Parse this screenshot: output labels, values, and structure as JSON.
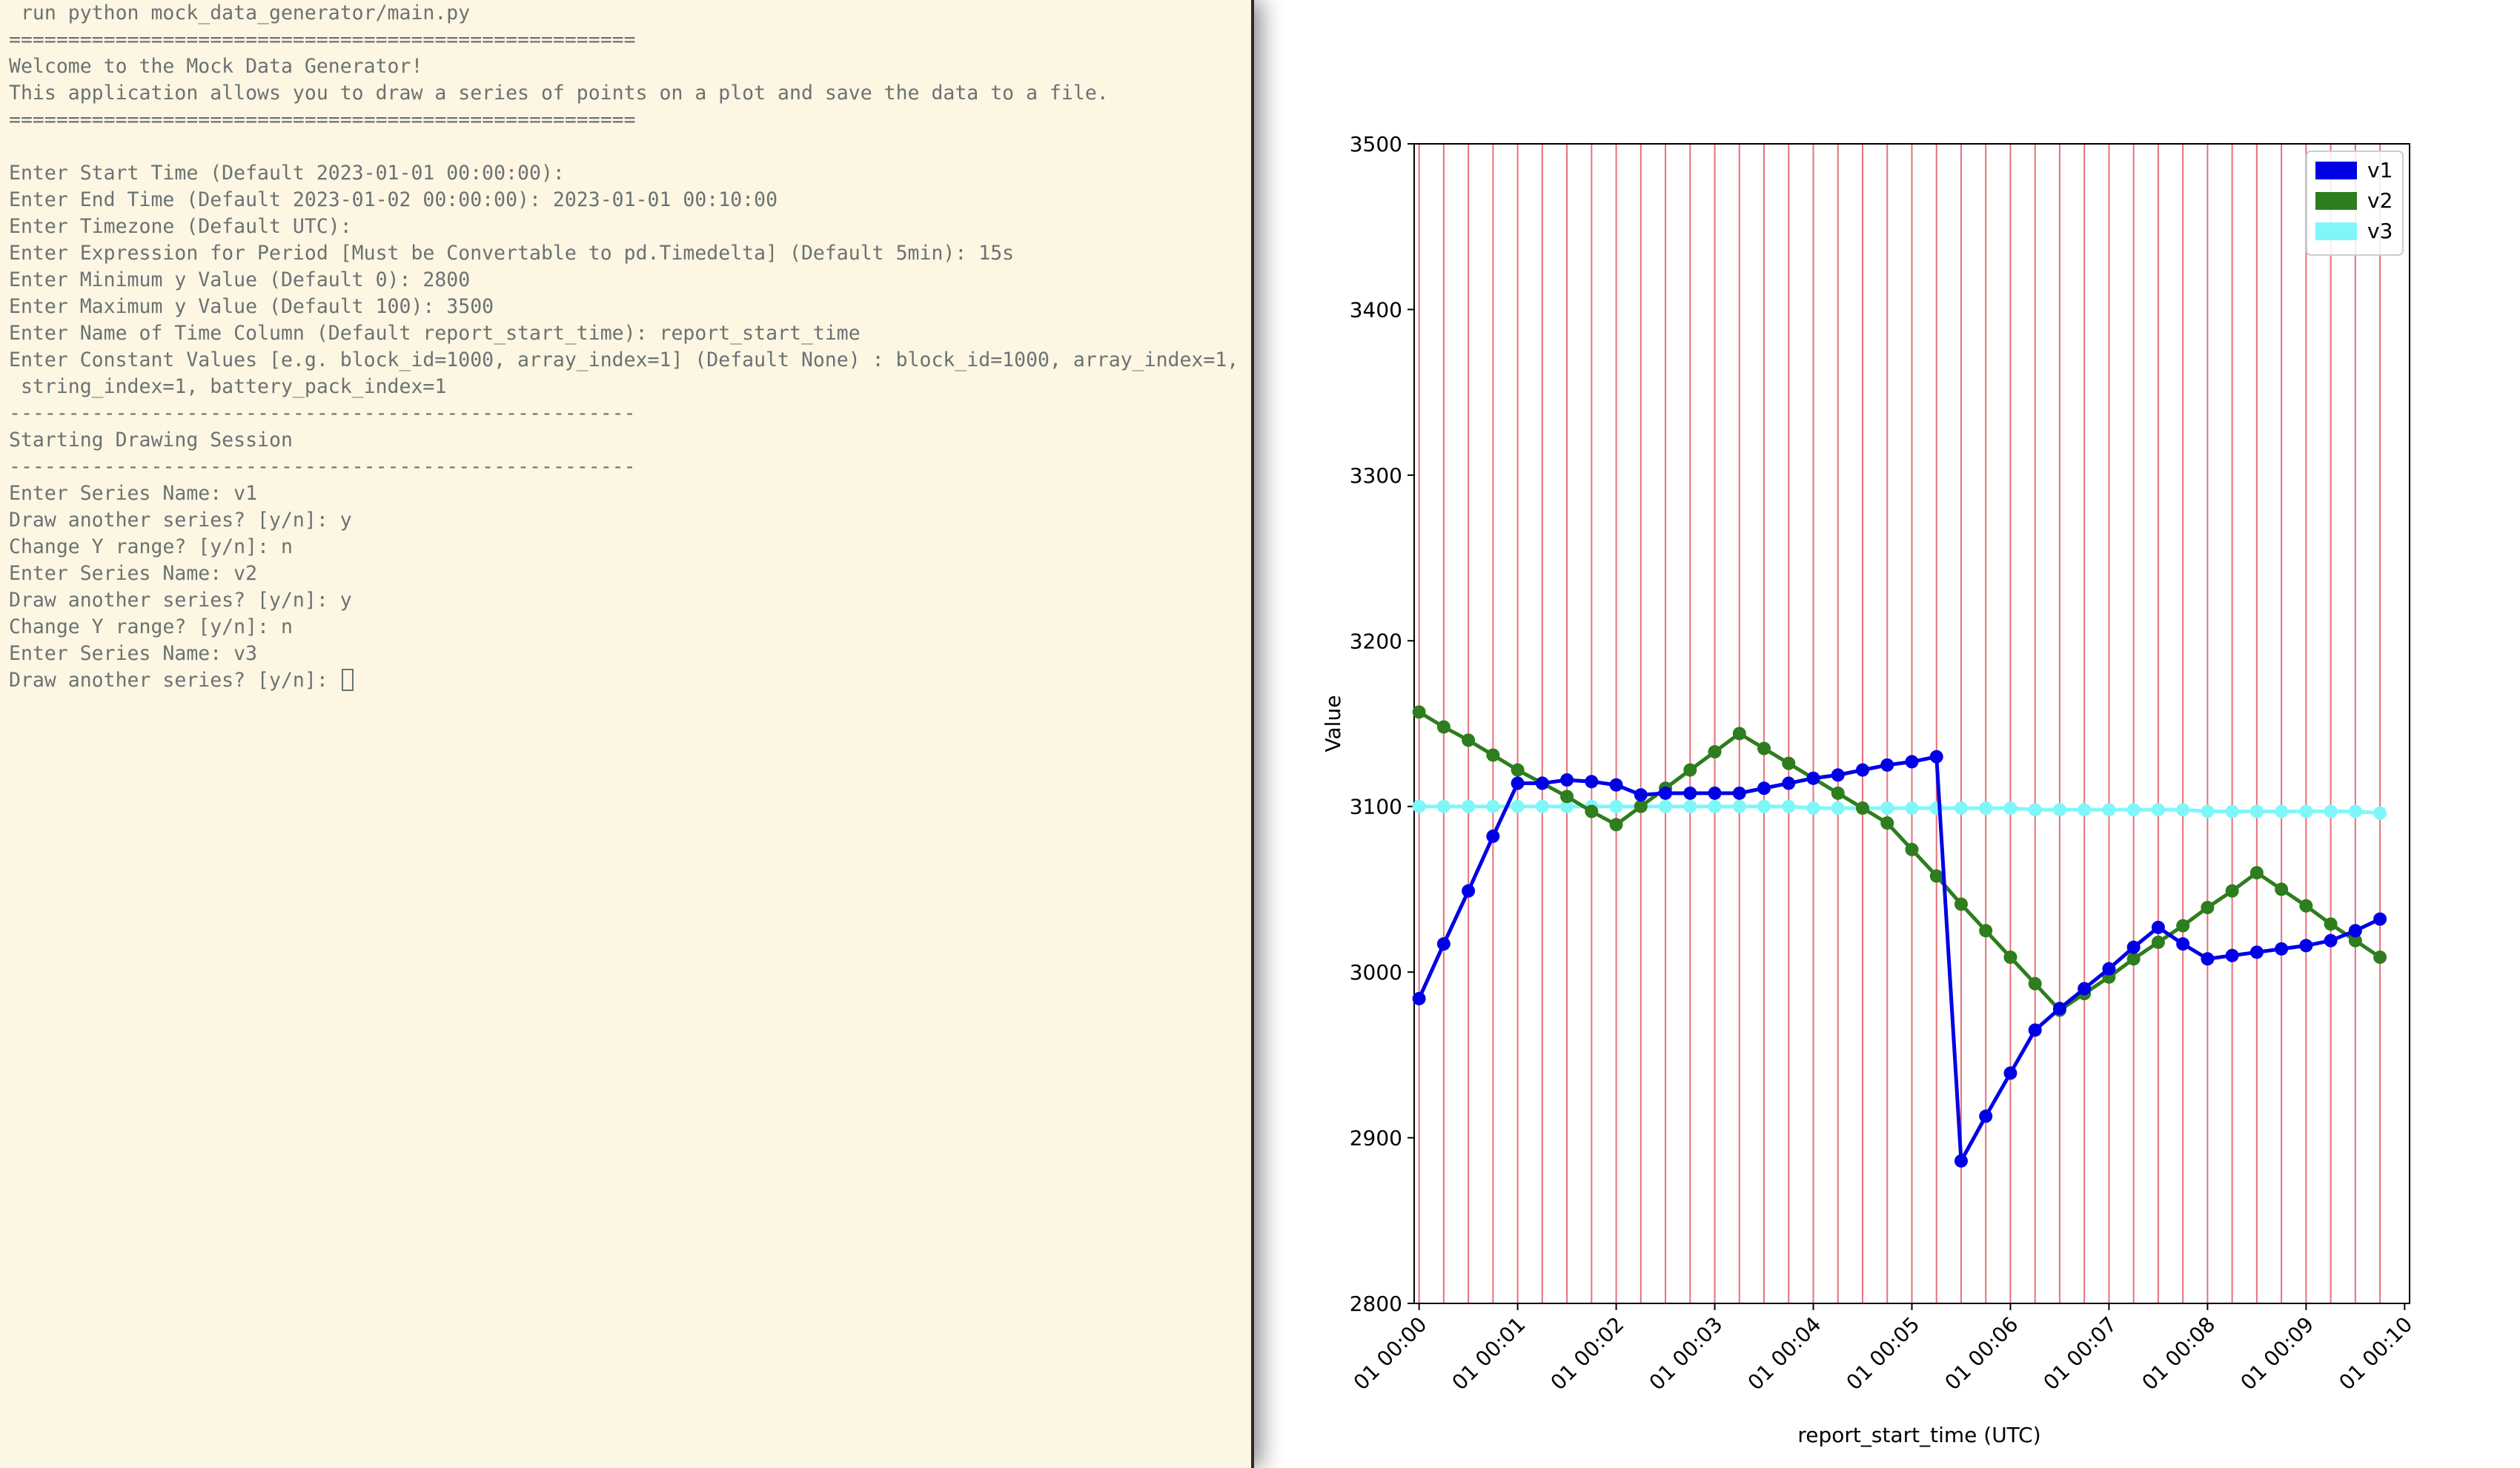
{
  "terminal": {
    "lines": [
      " run python mock_data_generator/main.py",
      "=====================================================",
      "Welcome to the Mock Data Generator!",
      "This application allows you to draw a series of points on a plot and save the data to a file.",
      "=====================================================",
      "",
      "Enter Start Time (Default 2023-01-01 00:00:00):",
      "Enter End Time (Default 2023-01-02 00:00:00): 2023-01-01 00:10:00",
      "Enter Timezone (Default UTC):",
      "Enter Expression for Period [Must be Convertable to pd.Timedelta] (Default 5min): 15s",
      "Enter Minimum y Value (Default 0): 2800",
      "Enter Maximum y Value (Default 100): 3500",
      "Enter Name of Time Column (Default report_start_time): report_start_time",
      "Enter Constant Values [e.g. block_id=1000, array_index=1] (Default None) : block_id=1000, array_index=1,",
      " string_index=1, battery_pack_index=1",
      "-----------------------------------------------------",
      "Starting Drawing Session",
      "-----------------------------------------------------",
      "Enter Series Name: v1",
      "Draw another series? [y/n]: y",
      "Change Y range? [y/n]: n",
      "Enter Series Name: v2",
      "Draw another series? [y/n]: y",
      "Change Y range? [y/n]: n",
      "Enter Series Name: v3"
    ],
    "prompt": "Draw another series? [y/n]: ",
    "colors": {
      "background": "#fdf6e3",
      "text": "#6b7273"
    }
  },
  "chart_data": {
    "type": "line",
    "title": "",
    "xlabel": "report_start_time (UTC)",
    "ylabel": "Value",
    "ylim": [
      2800,
      3500
    ],
    "y_ticks": [
      2800,
      2900,
      3000,
      3100,
      3200,
      3300,
      3400,
      3500
    ],
    "x_ticks": [
      "01 00:00",
      "01 00:01",
      "01 00:02",
      "01 00:03",
      "01 00:04",
      "01 00:05",
      "01 00:06",
      "01 00:07",
      "01 00:08",
      "01 00:09",
      "01 00:10"
    ],
    "x": [
      "00:00:00",
      "00:00:15",
      "00:00:30",
      "00:00:45",
      "00:01:00",
      "00:01:15",
      "00:01:30",
      "00:01:45",
      "00:02:00",
      "00:02:15",
      "00:02:30",
      "00:02:45",
      "00:03:00",
      "00:03:15",
      "00:03:30",
      "00:03:45",
      "00:04:00",
      "00:04:15",
      "00:04:30",
      "00:04:45",
      "00:05:00",
      "00:05:15",
      "00:05:30",
      "00:05:45",
      "00:06:00",
      "00:06:15",
      "00:06:30",
      "00:06:45",
      "00:07:00",
      "00:07:15",
      "00:07:30",
      "00:07:45",
      "00:08:00",
      "00:08:15",
      "00:08:30",
      "00:08:45",
      "00:09:00",
      "00:09:15",
      "00:09:30",
      "00:09:45"
    ],
    "vertical_lines_color": "#e8707a",
    "legend_location": "top-right",
    "series": [
      {
        "name": "v1",
        "color": "#0000e6",
        "values": [
          2984,
          3017,
          3049,
          3082,
          3114,
          3114,
          3116,
          3115,
          3113,
          3107,
          3108,
          3108,
          3108,
          3108,
          3111,
          3114,
          3117,
          3119,
          3122,
          3125,
          3127,
          3130,
          2886,
          2913,
          2939,
          2965,
          2978,
          2990,
          3002,
          3015,
          3027,
          3017,
          3008,
          3010,
          3012,
          3014,
          3016,
          3019,
          3025,
          3032
        ]
      },
      {
        "name": "v2",
        "color": "#2e7d1e",
        "values": [
          3157,
          3148,
          3140,
          3131,
          3122,
          3114,
          3106,
          3097,
          3089,
          3100,
          3111,
          3122,
          3133,
          3144,
          3135,
          3126,
          3117,
          3108,
          3099,
          3090,
          3074,
          3058,
          3041,
          3025,
          3009,
          2993,
          2977,
          2987,
          2997,
          3008,
          3018,
          3028,
          3039,
          3049,
          3060,
          3050,
          3040,
          3029,
          3019,
          3009
        ]
      },
      {
        "name": "v3",
        "color": "#7ff7f9",
        "values": [
          3100,
          3100,
          3100,
          3100,
          3100,
          3100,
          3100,
          3100,
          3100,
          3100,
          3100,
          3100,
          3100,
          3100,
          3100,
          3100,
          3099,
          3099,
          3099,
          3099,
          3099,
          3099,
          3099,
          3099,
          3099,
          3098,
          3098,
          3098,
          3098,
          3098,
          3098,
          3098,
          3097,
          3097,
          3097,
          3097,
          3097,
          3097,
          3097,
          3096
        ]
      }
    ]
  }
}
